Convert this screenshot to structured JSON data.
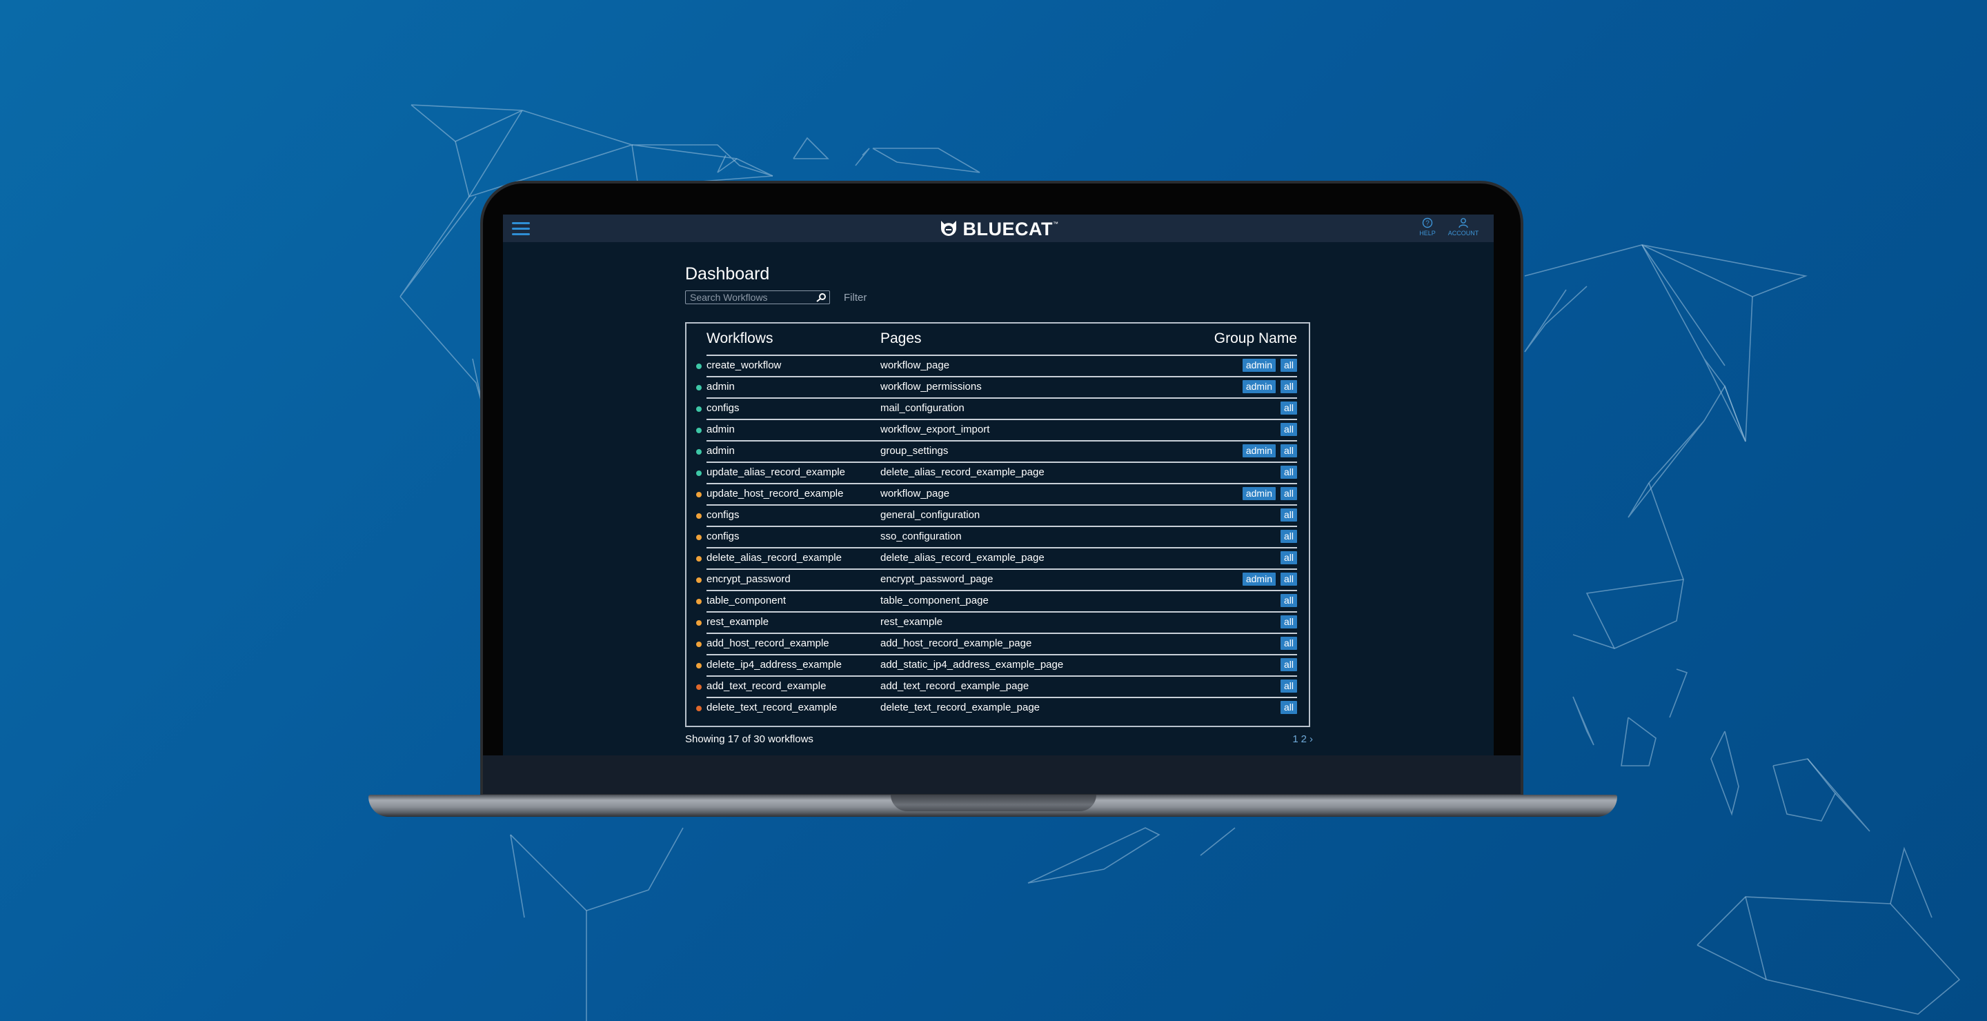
{
  "colors": {
    "background": "#0a6aa8",
    "app_bg": "#081a2a",
    "header_bg": "#1b2a3e",
    "accent": "#2b7fc3",
    "status_green": "#3ec7a6",
    "status_orange": "#f0a23a",
    "status_red": "#e0682b"
  },
  "header": {
    "logo": "BLUECAT",
    "logo_tm": "™",
    "menu_icon": "hamburger-menu-icon",
    "help_label": "HELP",
    "account_label": "ACCOUNT"
  },
  "dashboard": {
    "title": "Dashboard",
    "search_placeholder": "Search Workflows",
    "filter_label": "Filter"
  },
  "table": {
    "headers": {
      "workflows": "Workflows",
      "pages": "Pages",
      "group": "Group Name"
    },
    "rows": [
      {
        "workflow": "create_workflow",
        "page": "workflow_page",
        "groups": [
          "admin",
          "all"
        ],
        "status": "green"
      },
      {
        "workflow": "admin",
        "page": "workflow_permissions",
        "groups": [
          "admin",
          "all"
        ],
        "status": "green"
      },
      {
        "workflow": "configs",
        "page": "mail_configuration",
        "groups": [
          "all"
        ],
        "status": "green"
      },
      {
        "workflow": "admin",
        "page": "workflow_export_import",
        "groups": [
          "all"
        ],
        "status": "green"
      },
      {
        "workflow": "admin",
        "page": "group_settings",
        "groups": [
          "admin",
          "all"
        ],
        "status": "green"
      },
      {
        "workflow": "update_alias_record_example",
        "page": "delete_alias_record_example_page",
        "groups": [
          "all"
        ],
        "status": "green"
      },
      {
        "workflow": "update_host_record_example",
        "page": "workflow_page",
        "groups": [
          "admin",
          "all"
        ],
        "status": "orange"
      },
      {
        "workflow": "configs",
        "page": "general_configuration",
        "groups": [
          "all"
        ],
        "status": "orange"
      },
      {
        "workflow": "configs",
        "page": "sso_configuration",
        "groups": [
          "all"
        ],
        "status": "orange"
      },
      {
        "workflow": "delete_alias_record_example",
        "page": "delete_alias_record_example_page",
        "groups": [
          "all"
        ],
        "status": "orange"
      },
      {
        "workflow": "encrypt_password",
        "page": "encrypt_password_page",
        "groups": [
          "admin",
          "all"
        ],
        "status": "orange"
      },
      {
        "workflow": "table_component",
        "page": "table_component_page",
        "groups": [
          "all"
        ],
        "status": "orange"
      },
      {
        "workflow": "rest_example",
        "page": "rest_example",
        "groups": [
          "all"
        ],
        "status": "orange"
      },
      {
        "workflow": "add_host_record_example",
        "page": "add_host_record_example_page",
        "groups": [
          "all"
        ],
        "status": "orange"
      },
      {
        "workflow": "delete_ip4_address_example",
        "page": "add_static_ip4_address_example_page",
        "groups": [
          "all"
        ],
        "status": "orange"
      },
      {
        "workflow": "add_text_record_example",
        "page": "add_text_record_example_page",
        "groups": [
          "all"
        ],
        "status": "red"
      },
      {
        "workflow": "delete_text_record_example",
        "page": "delete_text_record_example_page",
        "groups": [
          "all"
        ],
        "status": "red"
      }
    ]
  },
  "footer": {
    "showing_text": "Showing 17 of 30 workflows",
    "pages": [
      "1",
      "2"
    ],
    "next_glyph": "›"
  }
}
